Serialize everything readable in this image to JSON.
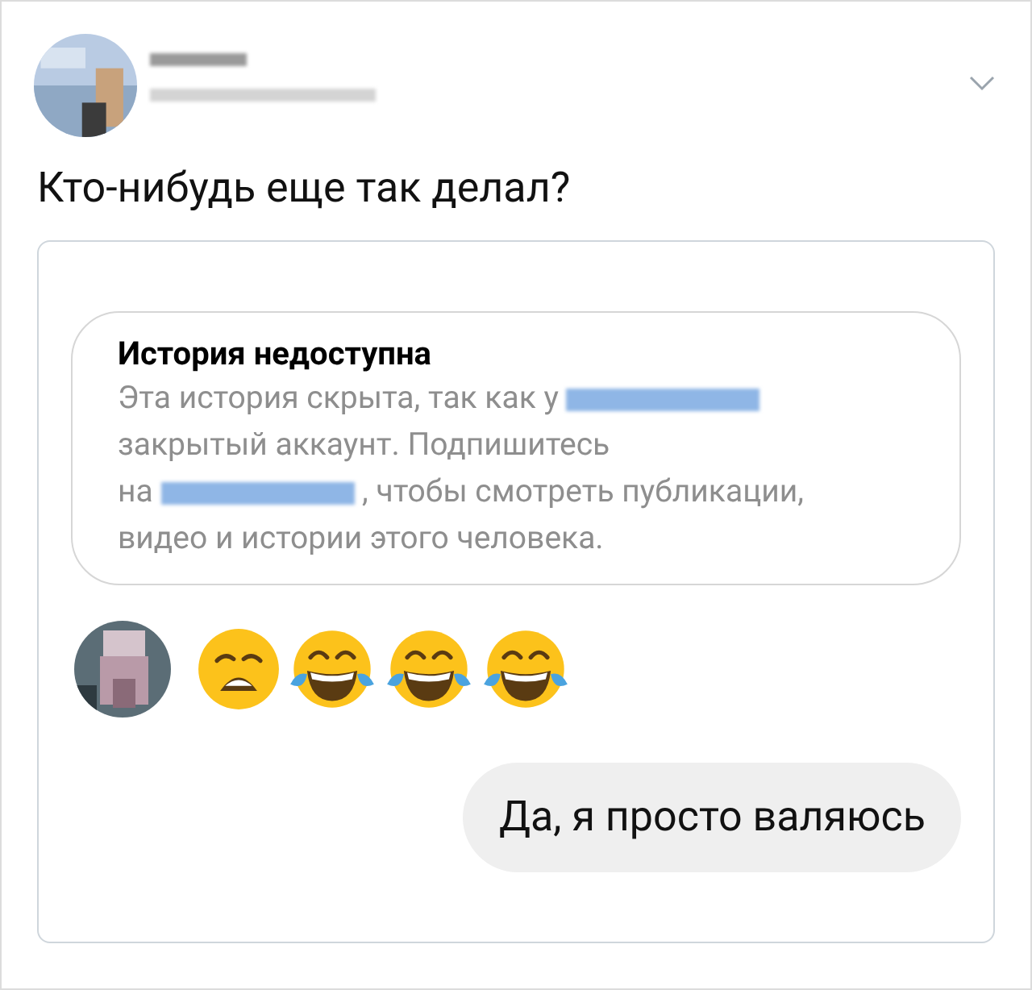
{
  "tweet": {
    "text": "Кто-нибудь еще так делал?"
  },
  "story_notice": {
    "title": "История недоступна",
    "body_lines": [
      [
        {
          "kind": "text",
          "text": "Эта история скрыта, так как у "
        },
        {
          "kind": "redacted"
        }
      ],
      [
        {
          "kind": "text",
          "text": "закрытый аккаунт. Подпишитесь"
        }
      ],
      [
        {
          "kind": "text",
          "text": "на "
        },
        {
          "kind": "redacted"
        },
        {
          "kind": "text",
          "text": " , чтобы смотреть публикации,"
        }
      ],
      [
        {
          "kind": "text",
          "text": "видео и истории этого человека."
        }
      ]
    ]
  },
  "reply": {
    "text": "Да, я просто валяюсь"
  }
}
